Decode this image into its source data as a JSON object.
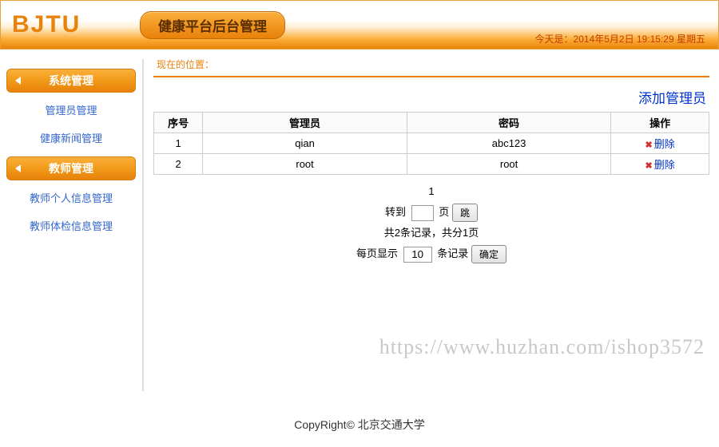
{
  "header": {
    "logo": "BJTU",
    "title": "健康平台后台管理",
    "date_prefix": "今天是：",
    "date_value": "2014年5月2日 19:15:29",
    "weekday": "星期五"
  },
  "sidebar": {
    "section1": {
      "label": "系统管理",
      "items": [
        "管理员管理",
        "健康新闻管理"
      ]
    },
    "section2": {
      "label": "教师管理",
      "items": [
        "教师个人信息管理",
        "教师体检信息管理"
      ]
    }
  },
  "breadcrumb": "现在的位置：",
  "actions": {
    "add": "添加管理员",
    "delete": "删除"
  },
  "table": {
    "headers": {
      "index": "序号",
      "admin": "管理员",
      "password": "密码",
      "op": "操作"
    },
    "rows": [
      {
        "index": "1",
        "admin": "qian",
        "password": "abc123"
      },
      {
        "index": "2",
        "admin": "root",
        "password": "root"
      }
    ]
  },
  "pager": {
    "current_page": "1",
    "goto_prefix": "转到",
    "goto_suffix": "页",
    "jump": "跳",
    "summary_a": "共",
    "record_count": "2",
    "summary_b": "条记录，共分",
    "page_count": "1",
    "summary_c": "页",
    "perpage_prefix": "每页显示",
    "perpage_value": "10",
    "perpage_suffix": "条记录",
    "confirm": "确定"
  },
  "watermark": "https://www.huzhan.com/ishop3572",
  "footer": {
    "copy": "CopyRight©",
    "org": "北京交通大学"
  }
}
